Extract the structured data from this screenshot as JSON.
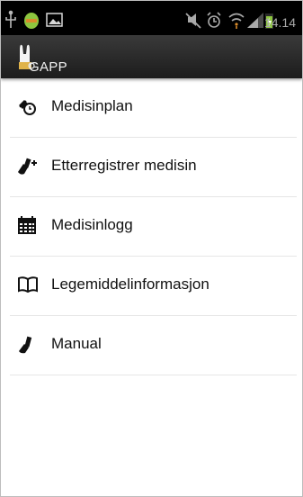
{
  "status_bar": {
    "time": "14.14",
    "icons": [
      "usb-icon",
      "android-debug-icon",
      "image-notification-icon",
      "mute-icon",
      "alarm-icon",
      "wifi-icon",
      "signal-icon",
      "battery-charging-icon"
    ]
  },
  "action_bar": {
    "title": "GAPP",
    "icon": "rabbit-app-icon"
  },
  "menu": {
    "items": [
      {
        "label": "Medisinplan",
        "icon": "pill-clock-icon"
      },
      {
        "label": "Etterregistrer medisin",
        "icon": "pill-add-icon"
      },
      {
        "label": "Medisinlogg",
        "icon": "calendar-icon"
      },
      {
        "label": "Legemiddelinformasjon",
        "icon": "book-icon"
      },
      {
        "label": "Manual",
        "icon": "pill-icon"
      }
    ]
  },
  "colors": {
    "status_bar_bg": "#000000",
    "action_bar_bg": "#2b2b2b",
    "list_bg": "#ffffff",
    "divider": "#e6e6e6",
    "text": "#111111",
    "battery_accent": "#8dc63f"
  }
}
